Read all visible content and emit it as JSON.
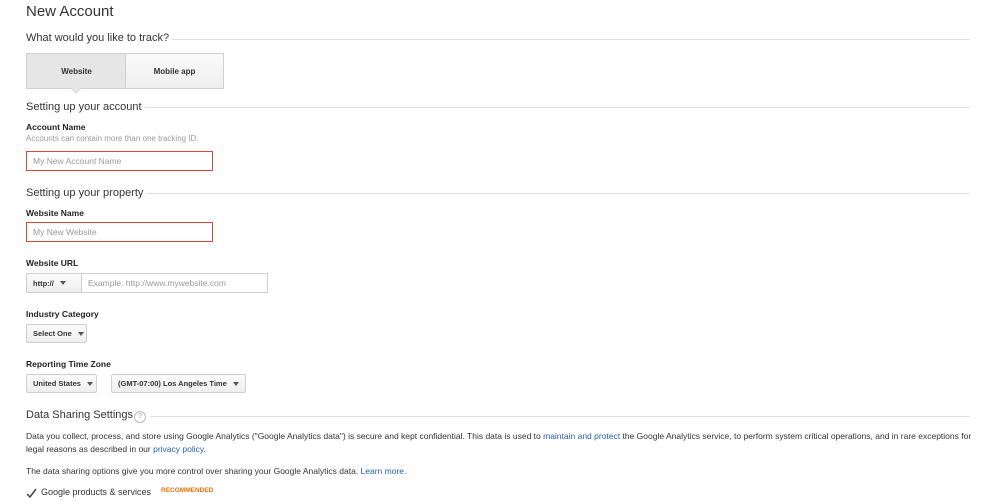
{
  "page": {
    "title": "New Account"
  },
  "track": {
    "heading": "What would you like to track?",
    "options": [
      "Website",
      "Mobile app"
    ],
    "selected": "Website"
  },
  "account": {
    "heading": "Setting up your account",
    "name_label": "Account Name",
    "name_help": "Accounts can contain more than one tracking ID.",
    "name_placeholder": "My New Account Name"
  },
  "property": {
    "heading": "Setting up your property",
    "website_name_label": "Website Name",
    "website_name_placeholder": "My New Website",
    "url_label": "Website URL",
    "protocol_value": "http://",
    "url_placeholder": "Example: http://www.mywebsite.com",
    "industry_label": "Industry Category",
    "industry_value": "Select One",
    "timezone_label": "Reporting Time Zone",
    "country_value": "United States",
    "timezone_value": "(GMT-07:00) Los Angeles Time"
  },
  "data_sharing": {
    "heading": "Data Sharing Settings",
    "help_icon": "?",
    "para1_part1": "Data you collect, process, and store using Google Analytics (\"Google Analytics data\") is secure and kept confidential. This data is used to ",
    "para1_link1": "maintain and protect",
    "para1_part2": " the Google Analytics service, to perform system critical operations, and in rare exceptions for legal reasons as described in our ",
    "para1_link2": "privacy policy",
    "para1_part3": ".",
    "para2_text": "The data sharing options give you more control over sharing your Google Analytics data. ",
    "para2_link": "Learn more.",
    "option_label": "Google products & services",
    "option_badge": "RECOMMENDED"
  },
  "colors": {
    "error_border": "#d9453a",
    "link": "#2a5db0",
    "badge": "#e8710a",
    "selected_tab_bg": "#e6e6e6"
  }
}
